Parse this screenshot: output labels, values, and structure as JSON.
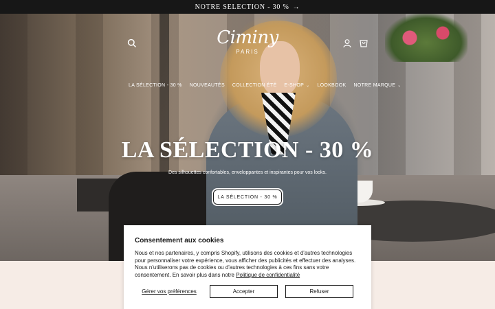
{
  "announcement": {
    "text": "NOTRE SELECTION - 30 %",
    "arrow": "→"
  },
  "logo": {
    "script": "Ciminy",
    "sub": "PARIS"
  },
  "header_icons": [
    "search-icon",
    "account-icon",
    "cart-icon"
  ],
  "nav": {
    "items": [
      {
        "label": "LA SÉLECTION - 30 %",
        "has_dropdown": false
      },
      {
        "label": "NOUVEAUTÉS",
        "has_dropdown": false
      },
      {
        "label": "COLLECTION ÉTÉ",
        "has_dropdown": false
      },
      {
        "label": "E-SHOP",
        "has_dropdown": true
      },
      {
        "label": "LOOKBOOK",
        "has_dropdown": false
      },
      {
        "label": "NOTRE MARQUE",
        "has_dropdown": true
      }
    ],
    "chevron": "⌄"
  },
  "hero": {
    "title": "LA SÉLECTION - 30 %",
    "subtitle": "Des silhouettes confortables, enveloppantes et inspirantes pour vos looks.",
    "button_label": "LA SÉLECTION - 30 %"
  },
  "cookie_banner": {
    "title": "Consentement aux cookies",
    "body_text": "Nous et nos partenaires, y compris Shopify, utilisons des cookies et d'autres technologies pour personnaliser votre expérience, vous afficher des publicités et effectuer des analyses. Nous n'utiliserons pas de cookies ou d'autres technologies à ces fins sans votre consentement. En savoir plus dans notre ",
    "policy_link": "Politique de confidentialité",
    "manage_label": "Gérer vos préférences",
    "accept_label": "Accepter",
    "refuse_label": "Refuser"
  },
  "colors": {
    "announcement_bg": "#171717",
    "page_bg": "#f6ece6",
    "text_dark": "#1a1a1a",
    "white": "#ffffff"
  }
}
